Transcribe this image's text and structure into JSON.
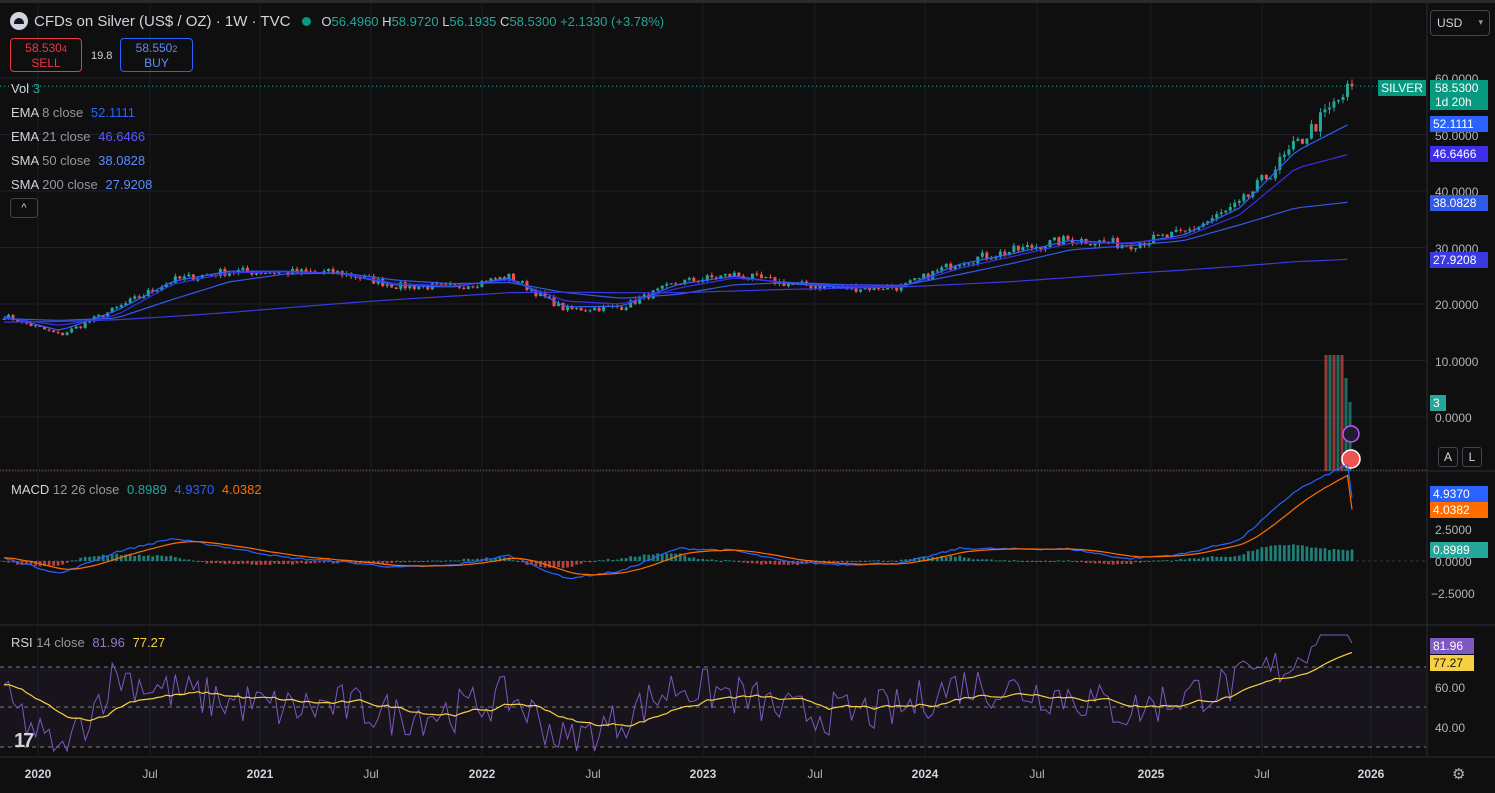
{
  "header": {
    "title": "CFDs on Silver (US$ / OZ) · 1W · TVC",
    "ohlc": {
      "o_label": "O",
      "o": "56.4960",
      "h_label": "H",
      "h": "58.9720",
      "l_label": "L",
      "l": "56.1935",
      "c_label": "C",
      "c": "58.5300",
      "change": "+2.1330 (+3.78%)"
    },
    "sell_price": "58.530",
    "sell_price_small": "4",
    "sell_label": "SELL",
    "buy_price": "58.550",
    "buy_price_small": "2",
    "buy_label": "BUY",
    "spread": "19.8",
    "currency": "USD"
  },
  "indicators": {
    "vol": {
      "name": "Vol",
      "value": "3"
    },
    "ema8": {
      "name": "EMA",
      "params": "8 close",
      "value": "52.1111",
      "color": "#2962ff"
    },
    "ema21": {
      "name": "EMA",
      "params": "21 close",
      "value": "46.6466",
      "color": "#3d2eea"
    },
    "sma50": {
      "name": "SMA",
      "params": "50 close",
      "value": "38.0828",
      "color": "#2f5be8"
    },
    "sma200": {
      "name": "SMA",
      "params": "200 close",
      "value": "27.9208",
      "color": "#3a3ae0"
    },
    "macd": {
      "name": "MACD",
      "params": "12 26 close",
      "hist": "0.8989",
      "macd": "4.9370",
      "signal": "4.0382"
    },
    "rsi": {
      "name": "RSI",
      "params": "14 close",
      "rsi": "81.96",
      "ma": "77.27"
    }
  },
  "price_axis": {
    "symbol_tag": "SILVER",
    "last_price": "58.5300",
    "countdown": "1d 20h",
    "ema8_tag": "52.1111",
    "ema21_tag": "46.6466",
    "sma50_tag": "38.0828",
    "sma200_tag": "27.9208",
    "vol_tag": "3",
    "ticks": [
      "60.0000",
      "50.0000",
      "40.0000",
      "30.0000",
      "20.0000",
      "10.0000",
      "0.0000"
    ]
  },
  "macd_axis": {
    "macd_tag": "4.9370",
    "signal_tag": "4.0382",
    "hist_tag": "0.8989",
    "ticks": [
      "2.5000",
      "0.0000",
      "−2.5000"
    ]
  },
  "rsi_axis": {
    "rsi_tag": "81.96",
    "ma_tag": "77.27",
    "ticks": [
      "60.00",
      "40.00"
    ]
  },
  "time_axis": [
    {
      "label": "2020",
      "year": true
    },
    {
      "label": "Jul",
      "year": false
    },
    {
      "label": "2021",
      "year": true
    },
    {
      "label": "Jul",
      "year": false
    },
    {
      "label": "2022",
      "year": true
    },
    {
      "label": "Jul",
      "year": false
    },
    {
      "label": "2023",
      "year": true
    },
    {
      "label": "Jul",
      "year": false
    },
    {
      "label": "2024",
      "year": true
    },
    {
      "label": "Jul",
      "year": false
    },
    {
      "label": "2025",
      "year": true
    },
    {
      "label": "Jul",
      "year": false
    },
    {
      "label": "2026",
      "year": true
    }
  ],
  "buttons": {
    "collapse": "^",
    "auto": "A",
    "log": "L"
  },
  "chart_data": {
    "type": "line",
    "title": "CFDs on Silver (US$ / OZ) · 1W · TVC",
    "x": [
      "2020-01",
      "2020-04",
      "2020-07",
      "2020-10",
      "2021-01",
      "2021-04",
      "2021-07",
      "2021-10",
      "2022-01",
      "2022-04",
      "2022-07",
      "2022-10",
      "2023-01",
      "2023-04",
      "2023-07",
      "2023-10",
      "2024-01",
      "2024-04",
      "2024-07",
      "2024-10",
      "2025-01",
      "2025-04",
      "2025-07",
      "2025-10",
      "2025-12"
    ],
    "series": [
      {
        "name": "",
        "values": [
          17.9,
          14.5,
          19.2,
          24.2,
          25.8,
          25.6,
          25.5,
          23.2,
          23.0,
          24.8,
          19.0,
          19.5,
          23.8,
          25.2,
          23.5,
          22.8,
          23.0,
          27.5,
          29.5,
          31.5,
          30.5,
          32.5,
          37.5,
          48.0,
          58.53
        ]
      },
      {
        "name": "EMA 8",
        "values": [
          17.8,
          15.3,
          18.8,
          24.0,
          25.8,
          25.8,
          25.4,
          23.3,
          23.0,
          24.6,
          19.5,
          19.6,
          23.5,
          24.9,
          23.6,
          22.9,
          23.0,
          27.0,
          29.0,
          31.3,
          30.6,
          32.2,
          37.0,
          47.0,
          52.11
        ]
      },
      {
        "name": "EMA 21",
        "values": [
          17.6,
          16.2,
          18.0,
          23.5,
          25.5,
          25.7,
          25.4,
          23.6,
          23.2,
          24.3,
          20.5,
          20.0,
          22.8,
          24.6,
          23.8,
          23.1,
          23.1,
          26.3,
          28.5,
          30.8,
          30.8,
          31.8,
          35.8,
          44.0,
          46.65
        ]
      },
      {
        "name": "SMA 50",
        "values": [
          17.4,
          17.1,
          17.5,
          20.8,
          23.9,
          25.3,
          25.5,
          24.2,
          23.6,
          23.8,
          22.0,
          21.0,
          21.7,
          23.4,
          23.8,
          23.4,
          23.3,
          25.2,
          27.3,
          29.6,
          30.3,
          31.2,
          34.0,
          37.0,
          38.08
        ]
      },
      {
        "name": "SMA 200",
        "values": [
          16.8,
          16.9,
          17.2,
          17.8,
          18.5,
          19.3,
          20.1,
          20.8,
          21.4,
          22.0,
          22.1,
          22.0,
          22.0,
          22.3,
          22.6,
          22.8,
          23.0,
          23.5,
          24.0,
          24.7,
          25.4,
          26.0,
          26.7,
          27.5,
          27.92
        ]
      }
    ],
    "ylim": [
      0,
      60
    ],
    "xlabel": "",
    "ylabel": "",
    "grid": true
  }
}
